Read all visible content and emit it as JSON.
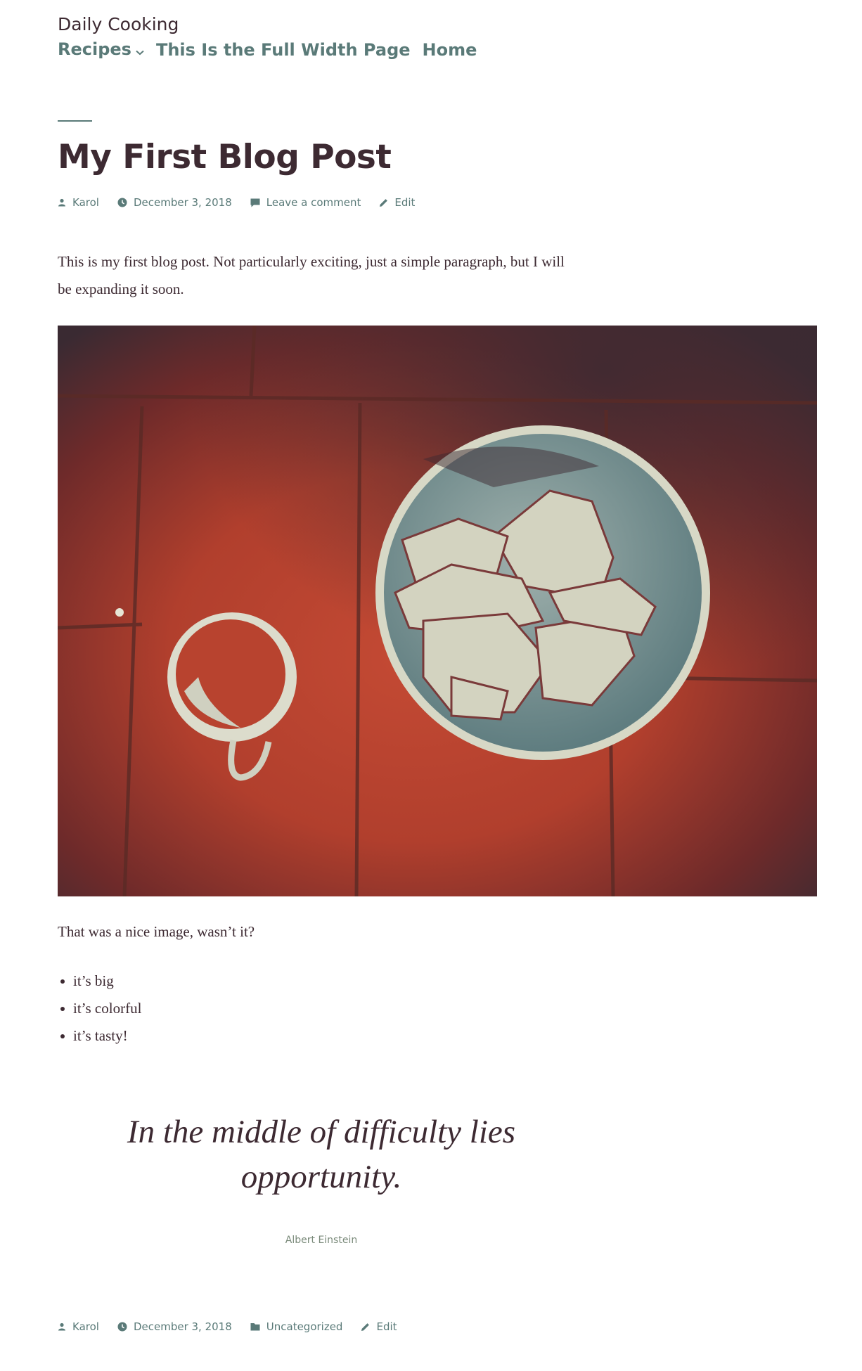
{
  "site": {
    "title": "Daily Cooking"
  },
  "nav": {
    "items": [
      {
        "label": "Recipes",
        "has_dropdown": true
      },
      {
        "label": "This Is the Full Width Page"
      },
      {
        "label": "Home"
      }
    ]
  },
  "post": {
    "title": "My First Blog Post",
    "meta_top": {
      "author": "Karol",
      "date": "December 3, 2018",
      "comment": "Leave a comment",
      "edit": "Edit"
    },
    "intro": "This is my first blog post. Not particularly exciting, just a simple paragraph, but I will be expanding it soon.",
    "after_image": "That was a nice image, wasn’t it?",
    "list": [
      "it’s big",
      "it’s colorful",
      "it’s tasty!"
    ],
    "quote": "In the middle of difficulty lies opportunity.",
    "quote_author": "Albert Einstein",
    "meta_bottom": {
      "author": "Karol",
      "date": "December 3, 2018",
      "category": "Uncategorized",
      "edit": "Edit"
    }
  },
  "colors": {
    "accent": "#5a7a78",
    "text": "#3d2a32",
    "background": "#ffffff"
  },
  "icons": [
    "chevron-down-icon",
    "author-icon",
    "clock-icon",
    "comment-icon",
    "edit-icon",
    "folder-icon"
  ]
}
